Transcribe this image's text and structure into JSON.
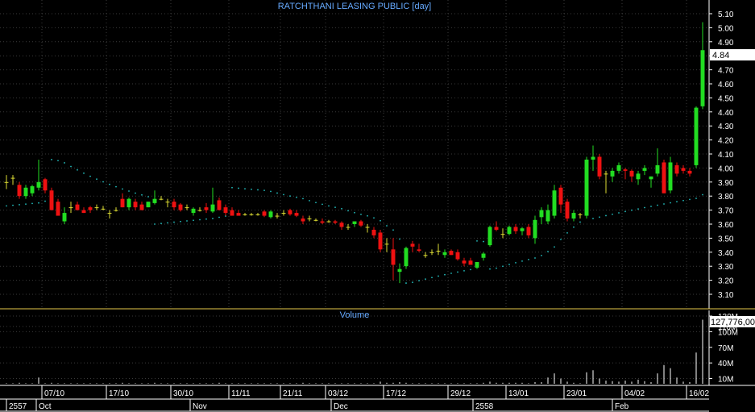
{
  "chart_data": [
    {
      "type": "candlestick",
      "title": "RATCHTHANI LEASING PUBLIC [day]",
      "ylim": [
        3.03,
        5.16
      ],
      "yticks": [
        "5.10",
        "5.00",
        "4.90",
        "4.80",
        "4.70",
        "4.60",
        "4.50",
        "4.40",
        "4.30",
        "4.20",
        "4.10",
        "4.00",
        "3.90",
        "3.80",
        "3.70",
        "3.60",
        "3.50",
        "3.40",
        "3.30",
        "3.20",
        "3.10"
      ],
      "last_price_label": "4.84",
      "last_price": 4.84,
      "grid": true,
      "colors": {
        "up": "#22dd22",
        "down": "#ee1111",
        "unchanged": "#dddd33",
        "sar": "#22bbbb",
        "grid": "#3a3a3a",
        "axis_text": "#ffffff",
        "title": "#66aaff"
      },
      "candles": [
        [
          3.9,
          3.95,
          3.85,
          3.9
        ],
        [
          3.93,
          3.95,
          3.88,
          3.93
        ],
        [
          3.88,
          3.9,
          3.78,
          3.8
        ],
        [
          3.8,
          3.88,
          3.78,
          3.86
        ],
        [
          3.82,
          3.88,
          3.8,
          3.87
        ],
        [
          3.86,
          4.06,
          3.84,
          3.9
        ],
        [
          3.92,
          3.93,
          3.82,
          3.84
        ],
        [
          3.84,
          3.86,
          3.7,
          3.7
        ],
        [
          3.76,
          3.78,
          3.66,
          3.66
        ],
        [
          3.62,
          3.72,
          3.6,
          3.68
        ],
        [
          3.72,
          3.76,
          3.68,
          3.72
        ],
        [
          3.74,
          3.76,
          3.7,
          3.7
        ],
        [
          3.7,
          3.72,
          3.68,
          3.68
        ],
        [
          3.72,
          3.73,
          3.68,
          3.7
        ],
        [
          3.72,
          3.74,
          3.7,
          3.72
        ],
        [
          3.71,
          3.73,
          3.7,
          3.71
        ],
        [
          3.68,
          3.7,
          3.64,
          3.68
        ],
        [
          3.7,
          3.72,
          3.69,
          3.7
        ],
        [
          3.78,
          3.82,
          3.72,
          3.72
        ],
        [
          3.72,
          3.79,
          3.7,
          3.78
        ],
        [
          3.76,
          3.78,
          3.7,
          3.72
        ],
        [
          3.74,
          3.76,
          3.7,
          3.7
        ],
        [
          3.72,
          3.76,
          3.72,
          3.76
        ],
        [
          3.75,
          3.84,
          3.74,
          3.78
        ],
        [
          3.78,
          3.8,
          3.77,
          3.78
        ],
        [
          3.76,
          3.78,
          3.72,
          3.76
        ],
        [
          3.76,
          3.78,
          3.7,
          3.72
        ],
        [
          3.74,
          3.75,
          3.69,
          3.7
        ],
        [
          3.72,
          3.74,
          3.7,
          3.72
        ],
        [
          3.68,
          3.72,
          3.66,
          3.71
        ],
        [
          3.7,
          3.72,
          3.69,
          3.7
        ],
        [
          3.72,
          3.75,
          3.68,
          3.7
        ],
        [
          3.69,
          3.86,
          3.68,
          3.74
        ],
        [
          3.77,
          3.79,
          3.7,
          3.7
        ],
        [
          3.72,
          3.74,
          3.66,
          3.68
        ],
        [
          3.7,
          3.72,
          3.66,
          3.66
        ],
        [
          3.68,
          3.7,
          3.66,
          3.66
        ],
        [
          3.67,
          3.68,
          3.66,
          3.67
        ],
        [
          3.67,
          3.68,
          3.66,
          3.67
        ],
        [
          3.67,
          3.68,
          3.66,
          3.67
        ],
        [
          3.69,
          3.7,
          3.65,
          3.66
        ],
        [
          3.65,
          3.7,
          3.64,
          3.69
        ],
        [
          3.66,
          3.68,
          3.64,
          3.66
        ],
        [
          3.68,
          3.7,
          3.66,
          3.68
        ],
        [
          3.7,
          3.71,
          3.66,
          3.67
        ],
        [
          3.68,
          3.7,
          3.65,
          3.66
        ],
        [
          3.64,
          3.66,
          3.6,
          3.62
        ],
        [
          3.64,
          3.66,
          3.62,
          3.64
        ],
        [
          3.63,
          3.64,
          3.62,
          3.63
        ],
        [
          3.62,
          3.64,
          3.6,
          3.61
        ],
        [
          3.62,
          3.63,
          3.61,
          3.62
        ],
        [
          3.62,
          3.63,
          3.6,
          3.61
        ],
        [
          3.61,
          3.62,
          3.56,
          3.58
        ],
        [
          3.58,
          3.6,
          3.56,
          3.58
        ],
        [
          3.6,
          3.62,
          3.58,
          3.62
        ],
        [
          3.62,
          3.63,
          3.58,
          3.59
        ],
        [
          3.58,
          3.6,
          3.54,
          3.58
        ],
        [
          3.56,
          3.58,
          3.5,
          3.52
        ],
        [
          3.54,
          3.56,
          3.4,
          3.42
        ],
        [
          3.46,
          3.5,
          3.4,
          3.46
        ],
        [
          3.42,
          3.5,
          3.2,
          3.31
        ],
        [
          3.26,
          3.32,
          3.18,
          3.28
        ],
        [
          3.3,
          3.44,
          3.28,
          3.43
        ],
        [
          3.46,
          3.48,
          3.4,
          3.44
        ],
        [
          3.42,
          3.46,
          3.4,
          3.41
        ],
        [
          3.38,
          3.4,
          3.36,
          3.38
        ],
        [
          3.4,
          3.42,
          3.38,
          3.4
        ],
        [
          3.41,
          3.46,
          3.38,
          3.41
        ],
        [
          3.38,
          3.42,
          3.36,
          3.4
        ],
        [
          3.41,
          3.42,
          3.38,
          3.38
        ],
        [
          3.4,
          3.42,
          3.34,
          3.35
        ],
        [
          3.34,
          3.36,
          3.3,
          3.32
        ],
        [
          3.34,
          3.36,
          3.31,
          3.31
        ],
        [
          3.29,
          3.33,
          3.28,
          3.33
        ],
        [
          3.36,
          3.4,
          3.34,
          3.39
        ],
        [
          3.45,
          3.59,
          3.44,
          3.58
        ],
        [
          3.58,
          3.62,
          3.55,
          3.56
        ],
        [
          3.53,
          3.57,
          3.5,
          3.53
        ],
        [
          3.53,
          3.59,
          3.52,
          3.58
        ],
        [
          3.58,
          3.6,
          3.53,
          3.55
        ],
        [
          3.55,
          3.58,
          3.52,
          3.57
        ],
        [
          3.58,
          3.6,
          3.5,
          3.52
        ],
        [
          3.5,
          3.66,
          3.46,
          3.63
        ],
        [
          3.65,
          3.72,
          3.6,
          3.7
        ],
        [
          3.62,
          3.74,
          3.6,
          3.7
        ],
        [
          3.66,
          3.88,
          3.64,
          3.84
        ],
        [
          3.86,
          3.88,
          3.68,
          3.74
        ],
        [
          3.76,
          3.78,
          3.62,
          3.64
        ],
        [
          3.64,
          3.7,
          3.62,
          3.68
        ],
        [
          3.67,
          3.68,
          3.64,
          3.67
        ],
        [
          3.66,
          4.08,
          3.64,
          4.06
        ],
        [
          4.06,
          4.16,
          3.98,
          4.08
        ],
        [
          4.08,
          4.1,
          3.92,
          3.94
        ],
        [
          3.96,
          3.98,
          3.82,
          3.96
        ],
        [
          3.94,
          4.0,
          3.9,
          3.98
        ],
        [
          3.98,
          4.04,
          3.96,
          4.02
        ],
        [
          3.99,
          4.0,
          3.92,
          3.98
        ],
        [
          3.98,
          3.99,
          3.9,
          3.94
        ],
        [
          3.92,
          3.98,
          3.88,
          3.96
        ],
        [
          3.98,
          4.02,
          3.95,
          4.0
        ],
        [
          3.92,
          3.94,
          3.86,
          3.94
        ],
        [
          3.96,
          4.14,
          3.94,
          4.02
        ],
        [
          4.04,
          4.06,
          3.82,
          3.82
        ],
        [
          3.84,
          4.08,
          3.82,
          4.04
        ],
        [
          4.02,
          4.04,
          3.94,
          3.96
        ],
        [
          4.0,
          4.02,
          3.96,
          3.98
        ],
        [
          3.98,
          4.0,
          3.94,
          3.96
        ],
        [
          4.02,
          4.44,
          4.0,
          4.43
        ],
        [
          4.44,
          5.04,
          4.42,
          4.84
        ]
      ],
      "sar": [
        null,
        null,
        null,
        null,
        null,
        null,
        null,
        null,
        null,
        null,
        null,
        null,
        null,
        null,
        null,
        null,
        null,
        null,
        null,
        null,
        null,
        null,
        null,
        null,
        null,
        null,
        null,
        null,
        null,
        null,
        null,
        null,
        null,
        null,
        null,
        null,
        null,
        null,
        null,
        null,
        null,
        null,
        null,
        null,
        null,
        null,
        null,
        null,
        null,
        null,
        null,
        null,
        null,
        null,
        null,
        null,
        null,
        null,
        null,
        null,
        null,
        null,
        null,
        null,
        null,
        null,
        null,
        null,
        null,
        null,
        null,
        null,
        null,
        null,
        null,
        null,
        null,
        null,
        null,
        null,
        null,
        null,
        null,
        null,
        null,
        null,
        null,
        null,
        null,
        null,
        null,
        null,
        null,
        null,
        null,
        null,
        null,
        null,
        null,
        null,
        null,
        null,
        null,
        null,
        null,
        null,
        null,
        null,
        null,
        null,
        null
      ],
      "volume_ylabel": "Volume",
      "volume_last_label": "127,776,00",
      "volume_yticks": [
        "130M",
        "110M",
        "100M",
        "70M",
        "40M",
        "10M"
      ],
      "volume_ylim": [
        0,
        130000000
      ],
      "volume": [
        1,
        1,
        2,
        1,
        1,
        12,
        1,
        2,
        1,
        1,
        1,
        1,
        1,
        1,
        1,
        1,
        1,
        1,
        2,
        1,
        1,
        1,
        1,
        2,
        1,
        1,
        1,
        1,
        1,
        1,
        1,
        1,
        1,
        2,
        1,
        1,
        1,
        1,
        1,
        1,
        1,
        1,
        1,
        1,
        1,
        1,
        2,
        1,
        1,
        1,
        1,
        1,
        1,
        1,
        1,
        1,
        1,
        1,
        4,
        2,
        2,
        3,
        2,
        1,
        1,
        1,
        1,
        1,
        1,
        1,
        1,
        1,
        1,
        1,
        2,
        4,
        2,
        2,
        2,
        2,
        2,
        1,
        3,
        3,
        12,
        20,
        10,
        4,
        2,
        1,
        22,
        26,
        10,
        6,
        5,
        4,
        6,
        4,
        8,
        5,
        3,
        20,
        36,
        30,
        12,
        4,
        3,
        60,
        123
      ],
      "xticks": [
        "07/10",
        "17/10",
        "30/10",
        "11/11",
        "21/11",
        "03/12",
        "17/12",
        "29/12",
        "13/01",
        "23/01",
        "04/02",
        "16/02"
      ],
      "period_labels": [
        "2557",
        "Oct",
        "Nov",
        "Dec",
        "2558",
        "Feb"
      ]
    }
  ]
}
